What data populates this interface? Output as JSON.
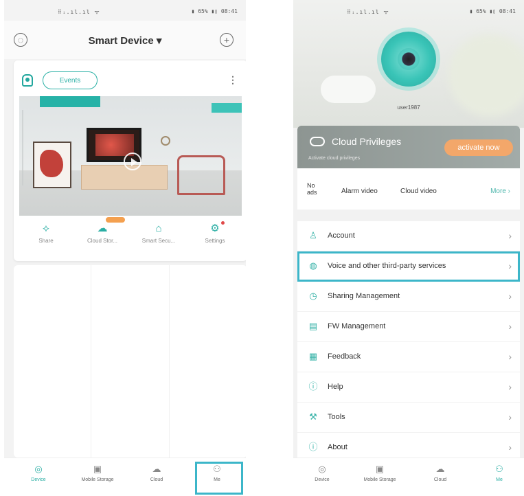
{
  "left_screen": {
    "status_bar": {
      "signal": "⠿ᵢ.ıl.ıl ᯤ",
      "battery": "▮ 65% ▮▯ 08:41"
    },
    "header": {
      "title": "Smart Device ▾",
      "left_icon": "settings-ring-icon",
      "right_icon": "add-circle-icon"
    },
    "device_card": {
      "events_label": "Events",
      "tools": [
        {
          "label": "Share",
          "icon": "share-icon",
          "glyph": "⟡"
        },
        {
          "label": "Cloud Stor...",
          "icon": "cloud-icon",
          "glyph": "☁"
        },
        {
          "label": "Smart Secu...",
          "icon": "home-icon",
          "glyph": "⌂"
        },
        {
          "label": "Settings",
          "icon": "gear-icon",
          "glyph": "⚙"
        }
      ]
    },
    "tabbar": [
      {
        "label": "Device",
        "glyph": "◎",
        "active": true
      },
      {
        "label": "Mobile Storage",
        "glyph": "▣",
        "active": false
      },
      {
        "label": "Cloud",
        "glyph": "☁",
        "active": false
      },
      {
        "label": "Me",
        "glyph": "⚇",
        "active": false
      }
    ]
  },
  "right_screen": {
    "status_bar": {
      "signal": "⠿ᵢ.ıl.ıl ᯤ",
      "battery": "▮ 65% ▮▯ 08:41"
    },
    "profile": {
      "username": "user1987"
    },
    "cloud_banner": {
      "title": "Cloud Privileges",
      "subtitle": "Activate cloud privileges",
      "button": "activate now"
    },
    "privileges": {
      "no_ads": "No ads",
      "alarm_video": "Alarm video",
      "cloud_video": "Cloud video",
      "more": "More ›"
    },
    "menu": [
      {
        "label": "Account",
        "glyph": "♙",
        "name": "account"
      },
      {
        "label": "Voice and other third-party services",
        "glyph": "◍",
        "name": "voice-services"
      },
      {
        "label": "Sharing Management",
        "glyph": "◷",
        "name": "sharing-management"
      },
      {
        "label": "FW Management",
        "glyph": "▤",
        "name": "fw-management"
      },
      {
        "label": "Feedback",
        "glyph": "▦",
        "name": "feedback"
      },
      {
        "label": "Help",
        "glyph": "ⓘ",
        "name": "help"
      },
      {
        "label": "Tools",
        "glyph": "⚒",
        "name": "tools"
      },
      {
        "label": "About",
        "glyph": "ⓘ",
        "name": "about"
      }
    ],
    "arrow": "›",
    "tabbar": [
      {
        "label": "Device",
        "glyph": "◎",
        "active": false
      },
      {
        "label": "Mobile Storage",
        "glyph": "▣",
        "active": false
      },
      {
        "label": "Cloud",
        "glyph": "☁",
        "active": false
      },
      {
        "label": "Me",
        "glyph": "⚇",
        "active": true
      }
    ]
  },
  "colors": {
    "accent": "#2aaea4",
    "highlight": "#3cb6c9",
    "activate": "#f3a76a",
    "banner": "#98a19e"
  }
}
